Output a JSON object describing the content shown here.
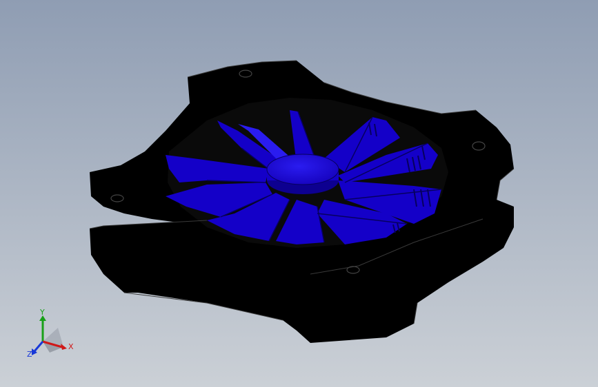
{
  "viewport": {
    "background_top": "#8f9db3",
    "background_bottom": "#cbd0d6",
    "model": {
      "housing_color": "#000000",
      "housing_edge_color": "#3a3a3a",
      "blade_color": "#1400c8",
      "blade_highlight": "#2a1cf0",
      "blade_shadow": "#07005e"
    }
  },
  "triad": {
    "x_label": "X",
    "y_label": "Y",
    "z_label": "Z",
    "x_color": "#d01818",
    "y_color": "#18a018",
    "z_color": "#1838d8"
  }
}
